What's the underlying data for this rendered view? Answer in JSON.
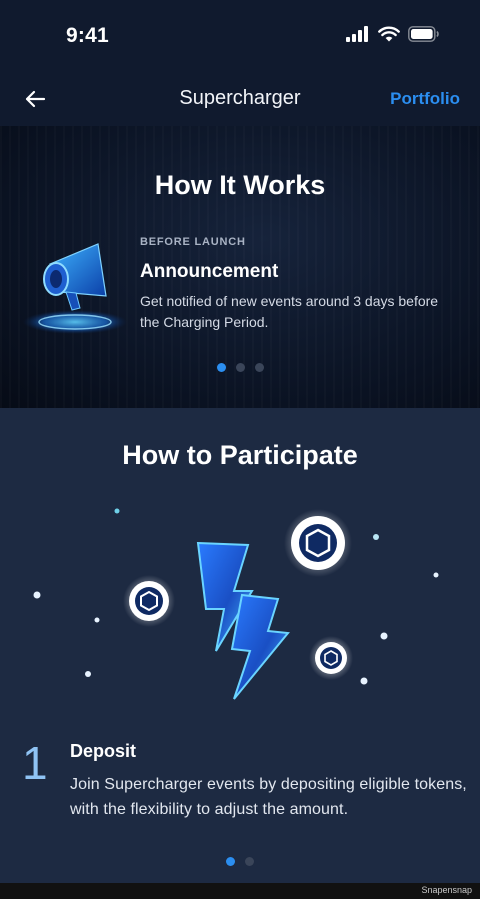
{
  "status_bar": {
    "time": "9:41",
    "icons": [
      "signal-icon",
      "wifi-icon",
      "battery-icon"
    ]
  },
  "nav": {
    "back_icon": "arrow-left-icon",
    "title": "Supercharger",
    "action_label": "Portfolio"
  },
  "how_it_works": {
    "title": "How It Works",
    "kicker": "BEFORE LAUNCH",
    "heading": "Announcement",
    "body": "Get notified of new events around 3 days before the Charging Period.",
    "illustration_icon": "megaphone-icon",
    "pager": {
      "count": 3,
      "active": 0
    }
  },
  "participate": {
    "title": "How to Participate",
    "illustration_icon": "lightning-coins-icon",
    "step_number": "1",
    "step_title": "Deposit",
    "step_body": "Join Supercharger events by depositing eligible tokens, with the flexibility to adjust the amount.",
    "pager": {
      "count": 2,
      "active": 0
    }
  },
  "footer": {
    "watermark": "Snapensnap"
  },
  "colors": {
    "accent": "#2b8ef0",
    "header_bg": "#101a2e",
    "section_bg": "#1d2a42"
  }
}
